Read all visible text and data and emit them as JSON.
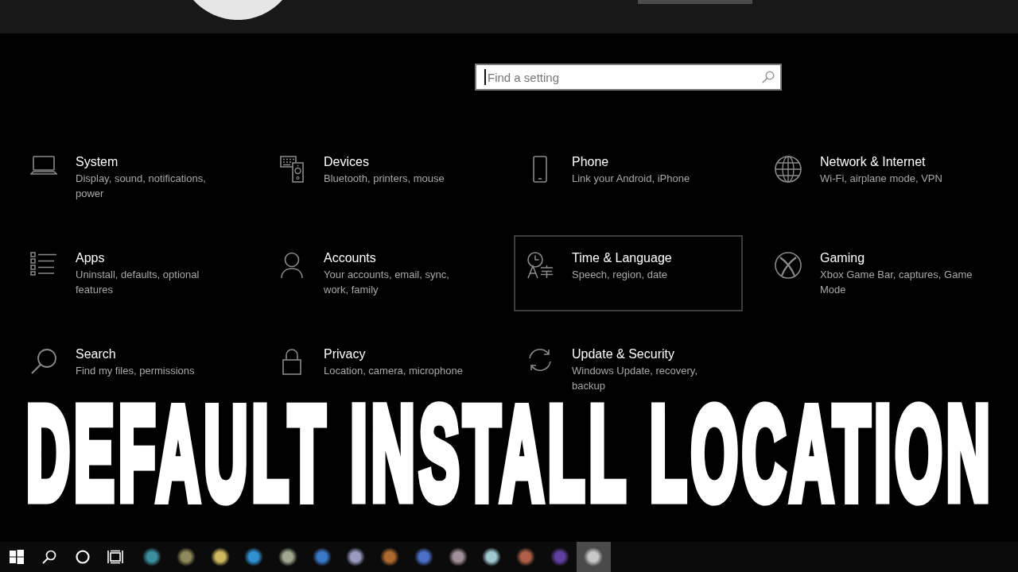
{
  "search": {
    "placeholder": "Find a setting"
  },
  "categories": [
    {
      "title": "System",
      "description_lines": [
        "Display, sound, notifications,",
        "power"
      ],
      "focused": false
    },
    {
      "title": "Devices",
      "description_lines": [
        "Bluetooth, printers, mouse"
      ],
      "focused": false
    },
    {
      "title": "Phone",
      "description_lines": [
        "Link your Android, iPhone"
      ],
      "focused": false
    },
    {
      "title": "Network & Internet",
      "description_lines": [
        "Wi-Fi, airplane mode, VPN"
      ],
      "focused": false
    },
    {
      "title": "Apps",
      "description_lines": [
        "Uninstall, defaults, optional",
        "features"
      ],
      "focused": false
    },
    {
      "title": "Accounts",
      "description_lines": [
        "Your accounts, email, sync,",
        "work, family"
      ],
      "focused": false
    },
    {
      "title": "Time & Language",
      "description_lines": [
        "Speech, region, date"
      ],
      "focused": true
    },
    {
      "title": "Gaming",
      "description_lines": [
        "Xbox Game Bar, captures, Game",
        "Mode"
      ],
      "focused": false
    },
    {
      "title": "Search",
      "description_lines": [
        "Find my files, permissions"
      ],
      "focused": false
    },
    {
      "title": "Privacy",
      "description_lines": [
        "Location, camera, microphone"
      ],
      "focused": false
    },
    {
      "title": "Update & Security",
      "description_lines": [
        "Windows Update, recovery,",
        "backup"
      ],
      "focused": false
    }
  ],
  "overlay_title": "DEFAULT INSTALL LOCATION",
  "taskbar": {
    "apps": [
      {
        "color": "#3b8fa0",
        "active": false
      },
      {
        "color": "#8f8a5a",
        "active": false
      },
      {
        "color": "#d0b860",
        "active": false
      },
      {
        "color": "#3090d0",
        "active": false
      },
      {
        "color": "#a0a890",
        "active": false
      },
      {
        "color": "#3a78c8",
        "active": false
      },
      {
        "color": "#9a9ac0",
        "active": false
      },
      {
        "color": "#b06a30",
        "active": false
      },
      {
        "color": "#4a70c8",
        "active": false
      },
      {
        "color": "#a09098",
        "active": false
      },
      {
        "color": "#a0c8d0",
        "active": false
      },
      {
        "color": "#b06048",
        "active": false
      },
      {
        "color": "#6040a0",
        "active": false
      },
      {
        "color": "#c8c8c8",
        "active": true
      }
    ]
  }
}
